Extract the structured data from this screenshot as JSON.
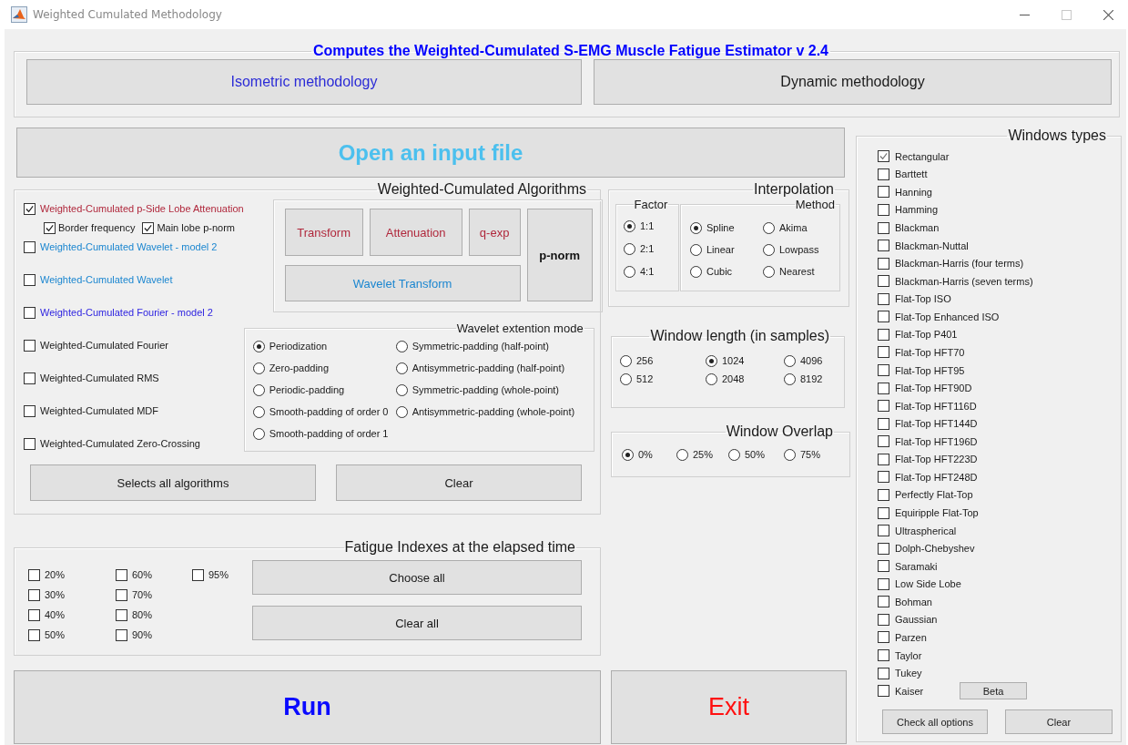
{
  "window": {
    "title": "Weighted Cumulated Methodology"
  },
  "header": {
    "title": "Computes the Weighted-Cumulated S-EMG Muscle Fatigue Estimator v 2.4",
    "buttons": [
      {
        "label": "Isometric methodology",
        "color": "#2b2bd6"
      },
      {
        "label": "Dynamic methodology",
        "color": "#1a1a1a"
      }
    ]
  },
  "open_button": {
    "label": "Open an input file",
    "color": "#4cc0ee"
  },
  "algorithms": {
    "title": "Weighted-Cumulated Algorithms",
    "items": [
      {
        "label": "Weighted-Cumulated p-Side Lobe Attenuation",
        "checked": true,
        "color": "#b0283c",
        "options": [
          {
            "label": "Border frequency",
            "checked": true
          },
          {
            "label": "Main lobe p-norm",
            "checked": true
          }
        ]
      },
      {
        "label": "Weighted-Cumulated Wavelet - model 2",
        "checked": false,
        "color": "#1b86d0"
      },
      {
        "label": "Weighted-Cumulated Wavelet",
        "checked": false,
        "color": "#1b86d0"
      },
      {
        "label": "Weighted-Cumulated Fourier - model 2",
        "checked": false,
        "color": "#2a1fe0"
      },
      {
        "label": "Weighted-Cumulated Fourier",
        "checked": false,
        "color": "#1a1a1a"
      },
      {
        "label": "Weighted-Cumulated RMS",
        "checked": false,
        "color": "#1a1a1a"
      },
      {
        "label": "Weighted-Cumulated MDF",
        "checked": false,
        "color": "#1a1a1a"
      },
      {
        "label": "Weighted-Cumulated Zero-Crossing",
        "checked": false,
        "color": "#1a1a1a"
      }
    ],
    "buttons": [
      {
        "label": "Transform",
        "color": "#b0283c"
      },
      {
        "label": "Attenuation",
        "color": "#b0283c"
      },
      {
        "label": "q-exp",
        "color": "#b0283c"
      },
      {
        "label": "p-norm",
        "color": "#111111"
      },
      {
        "label": "Wavelet Transform",
        "color": "#1b86d0"
      }
    ],
    "actions": [
      "Selects all algorithms",
      "Clear"
    ]
  },
  "wavelet_mode": {
    "title": "Wavelet extention mode",
    "options": [
      {
        "label": "Periodization",
        "selected": true
      },
      {
        "label": "Zero-padding",
        "selected": false
      },
      {
        "label": "Periodic-padding",
        "selected": false
      },
      {
        "label": "Smooth-padding of order 0",
        "selected": false
      },
      {
        "label": "Smooth-padding of order 1",
        "selected": false
      },
      {
        "label": "Symmetric-padding (half-point)",
        "selected": false
      },
      {
        "label": "Antisymmetric-padding (half-point)",
        "selected": false
      },
      {
        "label": "Symmetric-padding (whole-point)",
        "selected": false
      },
      {
        "label": "Antisymmetric-padding (whole-point)",
        "selected": false
      }
    ]
  },
  "fatigue": {
    "title": "Fatigue Indexes at the elapsed time",
    "items": [
      {
        "label": "20%",
        "checked": false
      },
      {
        "label": "30%",
        "checked": false
      },
      {
        "label": "40%",
        "checked": false
      },
      {
        "label": "50%",
        "checked": false
      },
      {
        "label": "60%",
        "checked": false
      },
      {
        "label": "70%",
        "checked": false
      },
      {
        "label": "80%",
        "checked": false
      },
      {
        "label": "90%",
        "checked": false
      },
      {
        "label": "95%",
        "checked": false
      }
    ],
    "buttons": [
      "Choose all",
      "Clear all"
    ]
  },
  "run_button": {
    "label": "Run",
    "color": "#0a0aff"
  },
  "interpolation": {
    "title": "Interpolation",
    "factor": {
      "title": "Factor",
      "options": [
        {
          "label": "1:1",
          "selected": true
        },
        {
          "label": "2:1",
          "selected": false
        },
        {
          "label": "4:1",
          "selected": false
        }
      ]
    },
    "method": {
      "title": "Method",
      "options": [
        {
          "label": "Spline",
          "selected": true
        },
        {
          "label": "Akima",
          "selected": false
        },
        {
          "label": "Linear",
          "selected": false
        },
        {
          "label": "Lowpass",
          "selected": false
        },
        {
          "label": "Cubic",
          "selected": false
        },
        {
          "label": "Nearest",
          "selected": false
        }
      ]
    }
  },
  "window_length": {
    "title": "Window length (in samples)",
    "options": [
      {
        "label": "256",
        "selected": false
      },
      {
        "label": "1024",
        "selected": true
      },
      {
        "label": "4096",
        "selected": false
      },
      {
        "label": "512",
        "selected": false
      },
      {
        "label": "2048",
        "selected": false
      },
      {
        "label": "8192",
        "selected": false
      }
    ]
  },
  "window_overlap": {
    "title": "Window Overlap",
    "options": [
      {
        "label": "0%",
        "selected": true
      },
      {
        "label": "25%",
        "selected": false
      },
      {
        "label": "50%",
        "selected": false
      },
      {
        "label": "75%",
        "selected": false
      }
    ]
  },
  "exit_button": {
    "label": "Exit",
    "color": "#ff1010"
  },
  "window_types": {
    "title": "Windows types",
    "items": [
      {
        "label": "Rectangular",
        "checked": true
      },
      {
        "label": "Barttett",
        "checked": false
      },
      {
        "label": "Hanning",
        "checked": false
      },
      {
        "label": "Hamming",
        "checked": false
      },
      {
        "label": "Blackman",
        "checked": false
      },
      {
        "label": "Blackman-Nuttal",
        "checked": false
      },
      {
        "label": "Blackman-Harris (four terms)",
        "checked": false
      },
      {
        "label": "Blackman-Harris (seven terms)",
        "checked": false
      },
      {
        "label": "Flat-Top ISO",
        "checked": false
      },
      {
        "label": "Flat-Top Enhanced ISO",
        "checked": false
      },
      {
        "label": "Flat-Top P401",
        "checked": false
      },
      {
        "label": "Flat-Top HFT70",
        "checked": false
      },
      {
        "label": "Flat-Top HFT95",
        "checked": false
      },
      {
        "label": "Flat-Top HFT90D",
        "checked": false
      },
      {
        "label": "Flat-Top HFT116D",
        "checked": false
      },
      {
        "label": "Flat-Top HFT144D",
        "checked": false
      },
      {
        "label": "Flat-Top HFT196D",
        "checked": false
      },
      {
        "label": "Flat-Top HFT223D",
        "checked": false
      },
      {
        "label": "Flat-Top HFT248D",
        "checked": false
      },
      {
        "label": "Perfectly Flat-Top",
        "checked": false
      },
      {
        "label": "Equiripple Flat-Top",
        "checked": false
      },
      {
        "label": "Ultraspherical",
        "checked": false
      },
      {
        "label": "Dolph-Chebyshev",
        "checked": false
      },
      {
        "label": "Saramaki",
        "checked": false
      },
      {
        "label": "Low Side Lobe",
        "checked": false
      },
      {
        "label": "Bohman",
        "checked": false
      },
      {
        "label": "Gaussian",
        "checked": false
      },
      {
        "label": "Parzen",
        "checked": false
      },
      {
        "label": "Taylor",
        "checked": false
      },
      {
        "label": "Tukey",
        "checked": false
      },
      {
        "label": "Kaiser",
        "checked": false
      }
    ],
    "beta_button": "Beta",
    "buttons": [
      "Check all options",
      "Clear"
    ]
  }
}
